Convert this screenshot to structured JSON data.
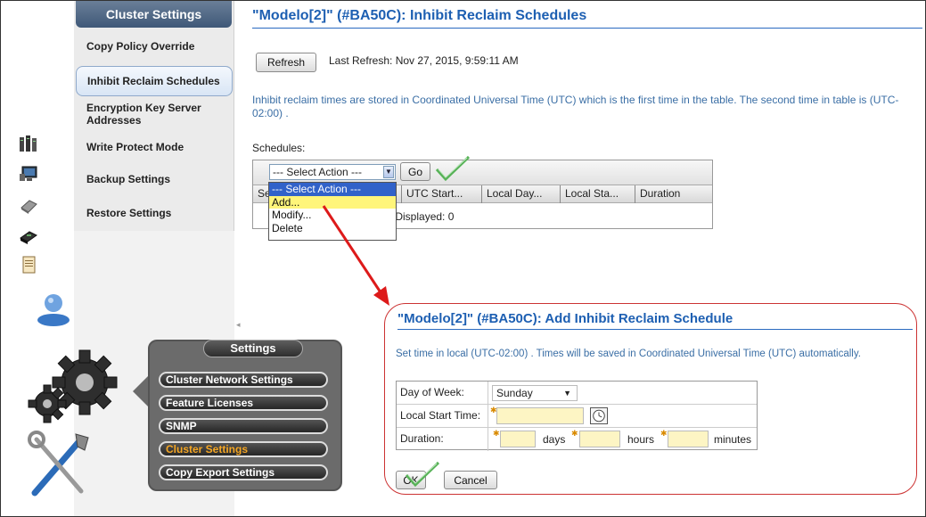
{
  "sidebar": {
    "header": "Cluster Settings",
    "items": [
      {
        "label": "Copy Policy Override"
      },
      {
        "label": "Inhibit Reclaim Schedules"
      },
      {
        "label": "Encryption Key Server Addresses"
      },
      {
        "label": "Write Protect Mode"
      },
      {
        "label": "Backup Settings"
      },
      {
        "label": "Restore Settings"
      }
    ]
  },
  "main": {
    "title": "\"Modelo[2]\" (#BA50C): Inhibit Reclaim Schedules",
    "refresh_label": "Refresh",
    "last_refresh": "Last Refresh:  Nov 27, 2015, 9:59:11 AM",
    "info": "Inhibit reclaim times are stored in Coordinated Universal Time (UTC) which is the first time in the table. The second time in table is (UTC-02:00) .",
    "schedules_label": "Schedules:",
    "select_action_value": "--- Select Action ---",
    "go_label": "Go",
    "columns": [
      "Se",
      "UTC Start...",
      "Local Day...",
      "Local Sta...",
      "Duration"
    ],
    "counts": "l: 0   Displayed: 0",
    "dropdown_options": [
      "--- Select Action ---",
      "Add...",
      "Modify...",
      "Delete"
    ]
  },
  "settings_popup": {
    "title": "Settings",
    "items": [
      {
        "label": "Cluster Network Settings"
      },
      {
        "label": "Feature Licenses"
      },
      {
        "label": "SNMP"
      },
      {
        "label": "Cluster Settings"
      },
      {
        "label": "Copy Export Settings"
      }
    ]
  },
  "add_dialog": {
    "title": "\"Modelo[2]\" (#BA50C): Add Inhibit Reclaim Schedule",
    "info": "Set time in local (UTC-02:00) . Times will be saved in Coordinated Universal Time (UTC) automatically.",
    "day_label": "Day of Week:",
    "day_value": "Sunday",
    "start_label": "Local Start Time:",
    "duration_label": "Duration:",
    "days_unit": "days",
    "hours_unit": "hours",
    "minutes_unit": "minutes",
    "ok_label": "OK",
    "cancel_label": "Cancel"
  },
  "colors": {
    "title_blue": "#1d5fb2",
    "info_blue": "#3a6ea5",
    "highlight_orange": "#f5a623",
    "annotation_red": "#cc2222",
    "check_green": "#4caf50"
  },
  "icons": [
    "server-rack-icon",
    "monitor-icon",
    "disk-drive-icon",
    "tape-drive-icon",
    "document-icon",
    "user-icon",
    "gear-icon",
    "tools-icon",
    "clock-icon",
    "checkmark-icon",
    "red-arrow-annotation"
  ]
}
